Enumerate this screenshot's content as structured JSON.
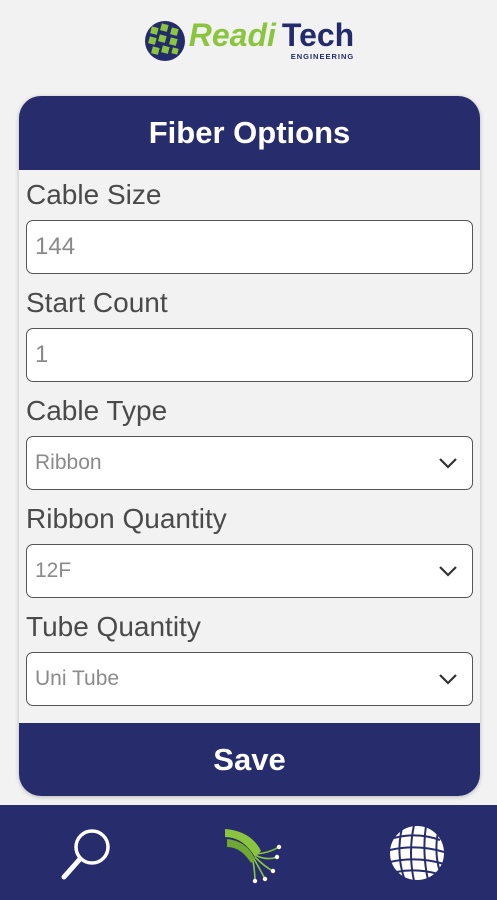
{
  "brand": {
    "name_part1": "Readi",
    "name_part2": "Tech",
    "subtitle": "ENGINEERING",
    "colors": {
      "green": "#8bc53f",
      "navy": "#232b6b"
    }
  },
  "form": {
    "title": "Fiber Options",
    "fields": [
      {
        "label": "Cable Size",
        "type": "text",
        "value": "144"
      },
      {
        "label": "Start Count",
        "type": "text",
        "value": "1"
      },
      {
        "label": "Cable Type",
        "type": "select",
        "value": "Ribbon"
      },
      {
        "label": "Ribbon Quantity",
        "type": "select",
        "value": "12F"
      },
      {
        "label": "Tube Quantity",
        "type": "select",
        "value": "Uni Tube"
      }
    ],
    "save_label": "Save"
  },
  "nav": {
    "items": [
      {
        "icon": "magnifier-icon",
        "label": "Search"
      },
      {
        "icon": "fiber-cable-icon",
        "label": "Fiber"
      },
      {
        "icon": "globe-icon",
        "label": "Globe"
      }
    ],
    "accent": "#8bc53f",
    "background": "#262c6c"
  }
}
